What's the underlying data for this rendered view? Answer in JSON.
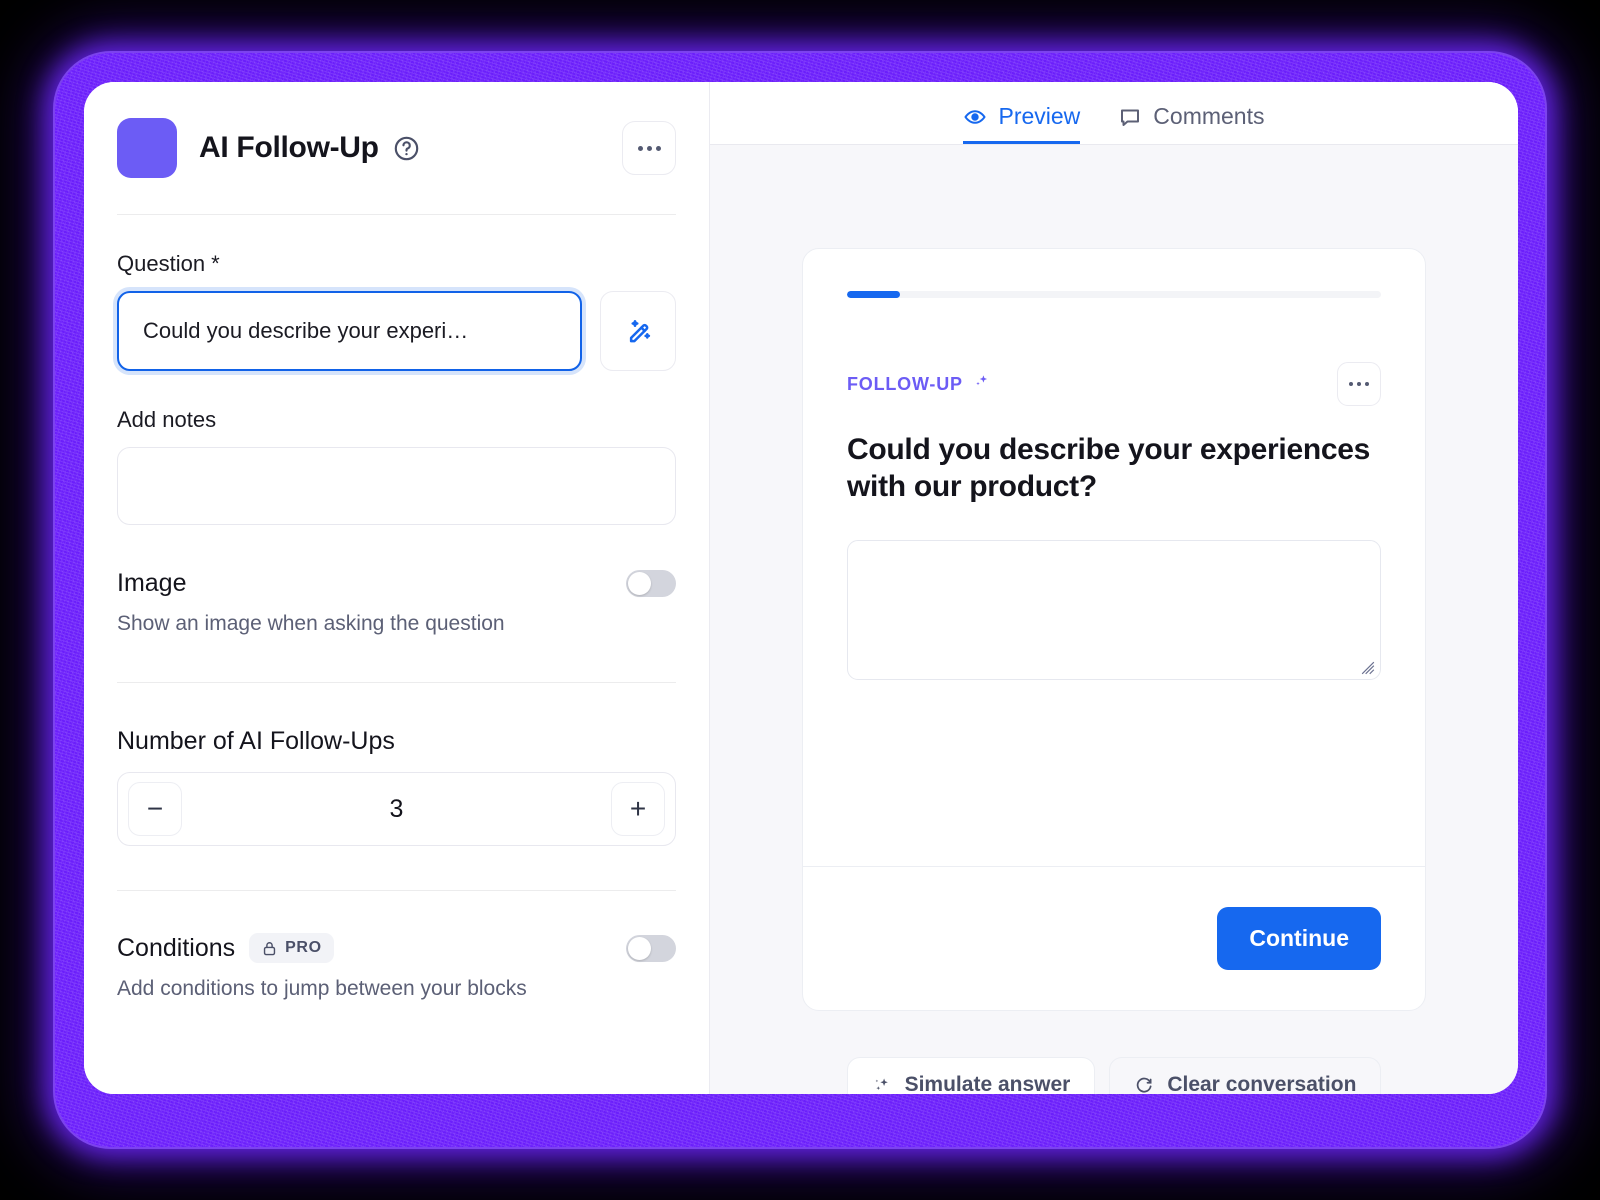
{
  "editor": {
    "block_title": "AI Follow-Up",
    "help_icon": "question-circle-icon",
    "swatch_color": "#6c5cf5",
    "kebab_icon": "more-options-icon",
    "fields": {
      "question_label": "Question *",
      "question_value": "Could you describe your experi…",
      "magic_icon": "magic-wand-edit-icon",
      "notes_label": "Add notes",
      "notes_value": "",
      "notes_placeholder": ""
    },
    "image_section": {
      "title": "Image",
      "description": "Show an image when asking the question",
      "toggle_state": "off"
    },
    "followups_section": {
      "title": "Number of AI Follow-Ups",
      "decrement_label": "−",
      "value": "3",
      "increment_label": "+"
    },
    "conditions_section": {
      "title": "Conditions",
      "badge_label": "PRO",
      "badge_icon": "lock-icon",
      "description": "Add conditions to jump between your blocks",
      "toggle_state": "off"
    }
  },
  "preview": {
    "tabs": [
      {
        "label": "Preview",
        "icon": "eye-icon",
        "active": true
      },
      {
        "label": "Comments",
        "icon": "comment-bubble-icon",
        "active": false
      }
    ],
    "progress_percent": 10,
    "card": {
      "tag_label": "FOLLOW-UP",
      "tag_icon": "sparkle-icon",
      "tag_color": "#6c5cf5",
      "kebab_icon": "more-options-icon",
      "question": "Could you describe your experiences with our product?",
      "answer_value": "",
      "answer_placeholder": "",
      "continue_label": "Continue",
      "continue_color": "#1668ef"
    },
    "actions": [
      {
        "label": "Simulate answer",
        "icon": "sparkles-icon"
      },
      {
        "label": "Clear conversation",
        "icon": "refresh-icon"
      }
    ]
  }
}
